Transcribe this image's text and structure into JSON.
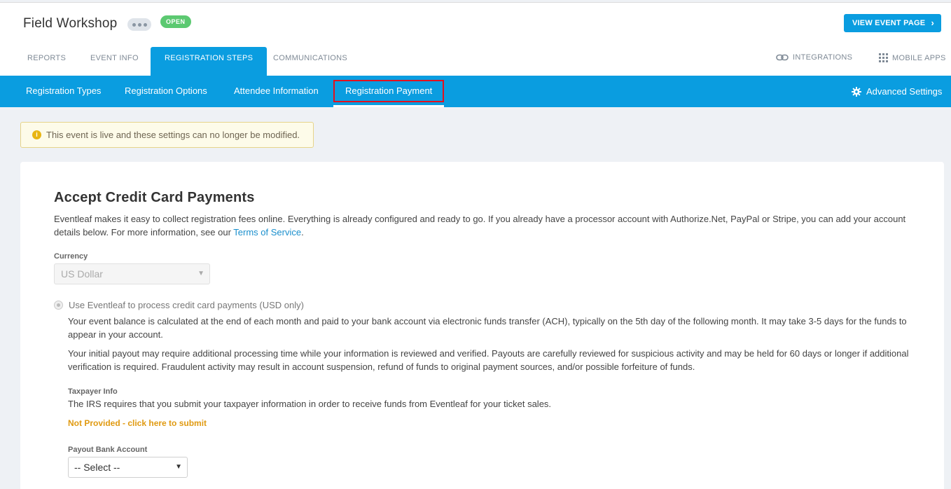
{
  "header": {
    "event_title": "Field Workshop",
    "status_badge": "OPEN",
    "view_event_label": "VIEW EVENT PAGE",
    "tabs": [
      {
        "label": "REPORTS"
      },
      {
        "label": "EVENT INFO"
      },
      {
        "label": "REGISTRATION STEPS",
        "active": true
      },
      {
        "label": "COMMUNICATIONS"
      }
    ],
    "integrations_label": "INTEGRATIONS",
    "mobile_apps_label": "MOBILE APPS"
  },
  "subnav": {
    "items": [
      {
        "label": "Registration Types"
      },
      {
        "label": "Registration Options"
      },
      {
        "label": "Attendee Information"
      },
      {
        "label": "Registration Payment",
        "active": true
      }
    ],
    "advanced_settings_label": "Advanced Settings"
  },
  "alert": {
    "text": "This event is live and these settings can no longer be modified."
  },
  "payment": {
    "title": "Accept Credit Card Payments",
    "description": "Eventleaf makes it easy to collect registration fees online. Everything is already configured and ready to go. If you already have a processor account with Authorize.Net, PayPal or Stripe, you can add your account details below. For more information, see our ",
    "terms_link": "Terms of Service",
    "description_end": ".",
    "currency_label": "Currency",
    "currency_value": "US Dollar",
    "radio_label": "Use Eventleaf to process credit card payments (USD only)",
    "balance_text": "Your event balance is calculated at the end of each month and paid to your bank account via electronic funds transfer (ACH), typically on the 5th day of the following month. It may take 3-5 days for the funds to appear in your account.",
    "payout_text": "Your initial payout may require additional processing time while your information is reviewed and verified. Payouts are carefully reviewed for suspicious activity and may be held for 60 days or longer if additional verification is required. Fraudulent activity may result in account suspension, refund of funds to original payment sources, and/or possible forfeiture of funds.",
    "taxpayer_label": "Taxpayer Info",
    "taxpayer_text": "The IRS requires that you submit your taxpayer information in order to receive funds from Eventleaf for your ticket sales.",
    "taxpayer_link": "Not Provided - click here to submit",
    "bank_label": "Payout Bank Account",
    "bank_value": "-- Select --"
  },
  "colors": {
    "brand_blue": "#0a9de0",
    "open_green": "#5cc971",
    "warning_orange": "#e09a11",
    "highlight_red": "#e3101e"
  }
}
